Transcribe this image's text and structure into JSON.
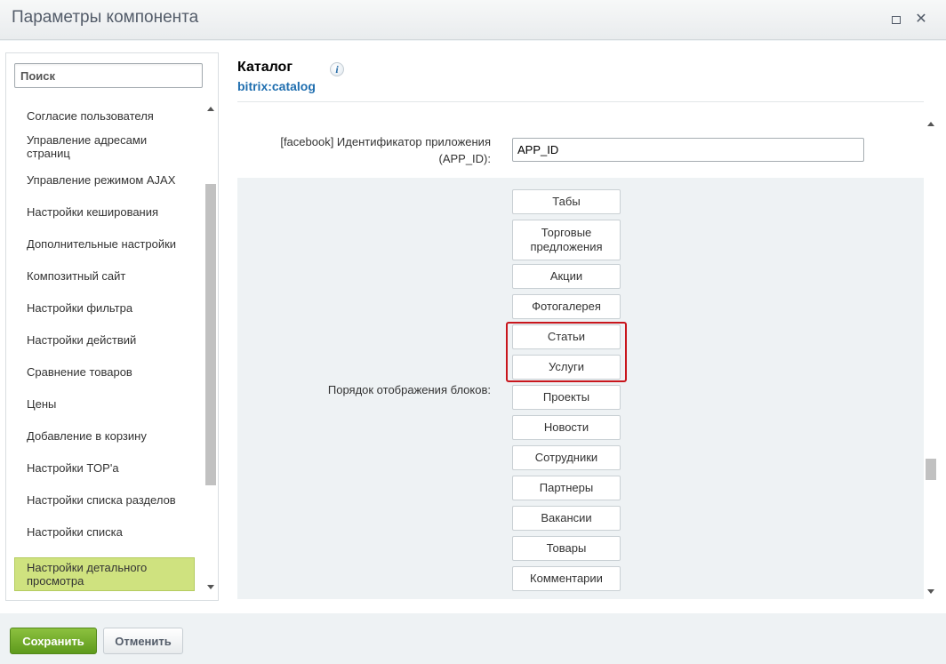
{
  "window": {
    "title": "Параметры компонента",
    "maximize_icon": "maximize-icon",
    "close_icon": "close-icon",
    "close_glyph": "✕"
  },
  "sidebar": {
    "search_placeholder": "Поиск",
    "items": [
      {
        "label": "Согласие пользователя"
      },
      {
        "label": "Управление адресами страниц"
      },
      {
        "label": "Управление режимом AJAX"
      },
      {
        "label": "Настройки кеширования"
      },
      {
        "label": "Дополнительные настройки"
      },
      {
        "label": "Композитный сайт"
      },
      {
        "label": "Настройки фильтра"
      },
      {
        "label": "Настройки действий"
      },
      {
        "label": "Сравнение товаров"
      },
      {
        "label": "Цены"
      },
      {
        "label": "Добавление в корзину"
      },
      {
        "label": "Настройки TOP'а"
      },
      {
        "label": "Настройки списка разделов"
      },
      {
        "label": "Настройки списка"
      },
      {
        "label": "Настройки детального просмотра",
        "active": true
      }
    ],
    "active_color": "#cfe27f"
  },
  "component": {
    "title": "Каталог",
    "code": "bitrix:catalog",
    "info_icon": "info-icon",
    "info_glyph": "i"
  },
  "params": {
    "app_id_label": "[facebook] Идентификатор приложения (APP_ID):",
    "app_id_value": "APP_ID",
    "order_label": "Порядок отображения блоков:",
    "blocks": [
      "Табы",
      "Торговые предложения",
      "Акции",
      "Фотогалерея",
      "Статьи",
      "Услуги",
      "Проекты",
      "Новости",
      "Сотрудники",
      "Партнеры",
      "Вакансии",
      "Товары",
      "Комментарии"
    ],
    "highlighted_blocks": [
      "Статьи",
      "Услуги"
    ],
    "highlight_color": "#c8161c"
  },
  "footer": {
    "save_label": "Сохранить",
    "cancel_label": "Отменить",
    "save_color": "#6aa628"
  }
}
